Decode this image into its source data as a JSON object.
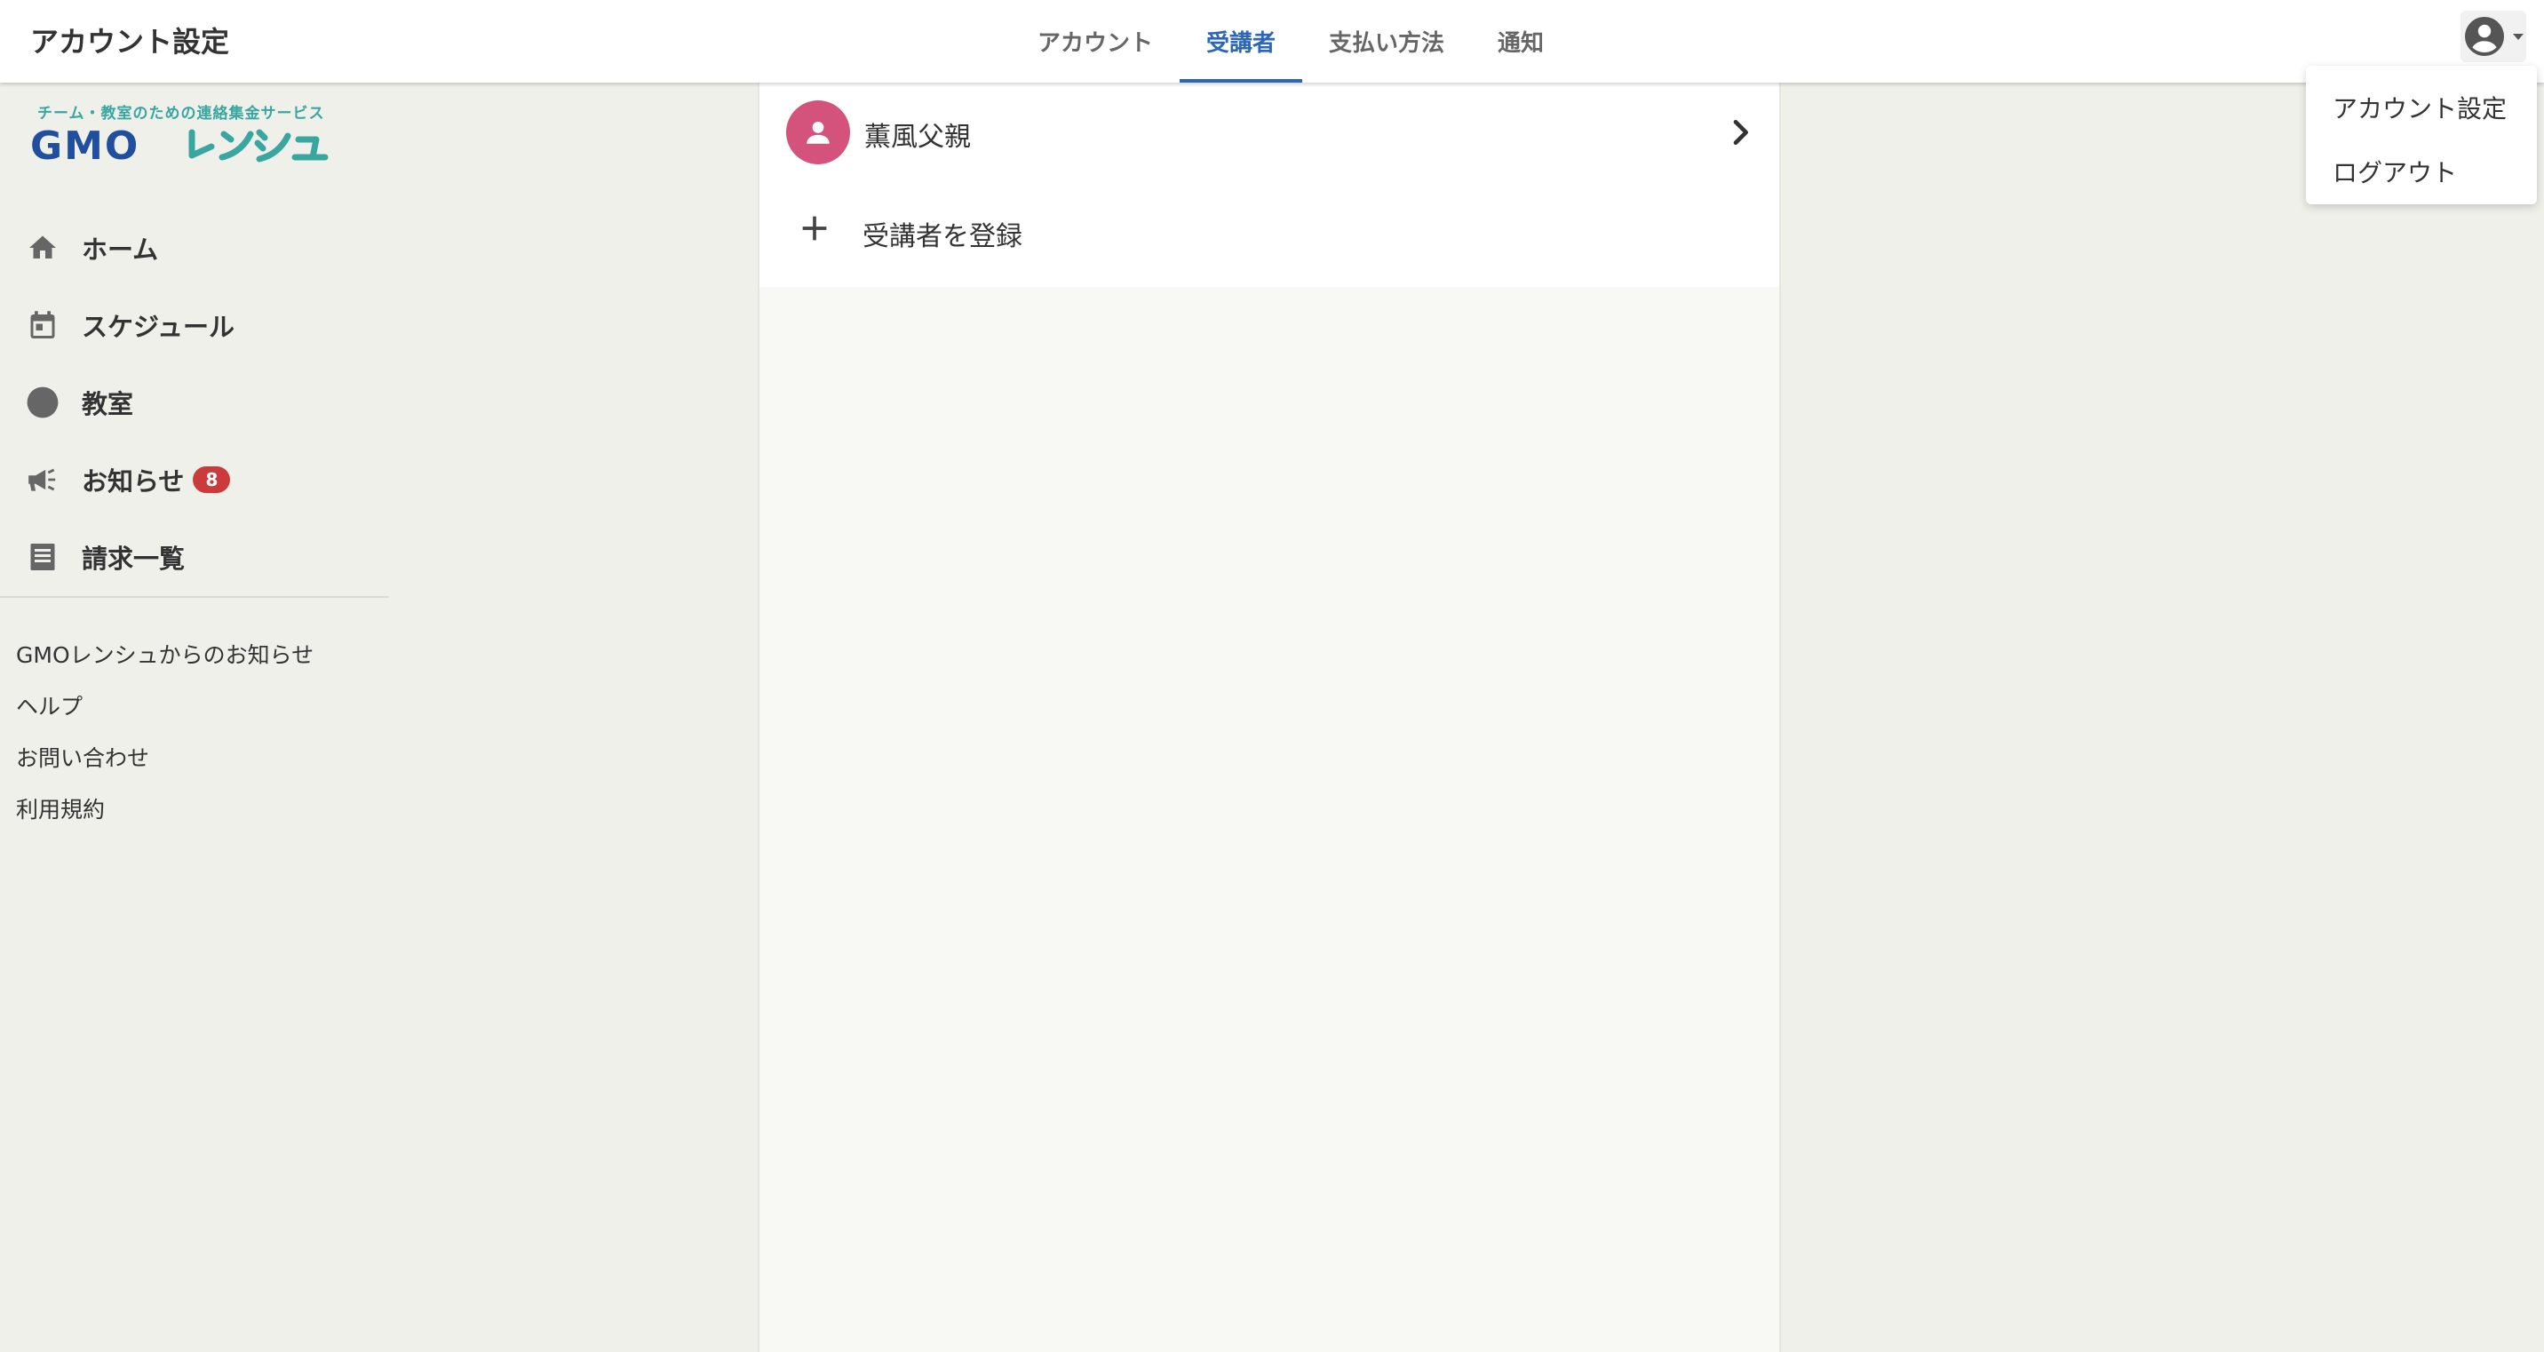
{
  "header": {
    "title": "アカウント設定",
    "tabs": [
      {
        "label": "アカウント"
      },
      {
        "label": "受講者",
        "active": true
      },
      {
        "label": "支払い方法"
      },
      {
        "label": "通知"
      }
    ],
    "account_icon": "account-circle-icon"
  },
  "dropdown": {
    "items": [
      {
        "label": "アカウント設定"
      },
      {
        "label": "ログアウト"
      }
    ]
  },
  "sidebar": {
    "logo": {
      "tagline": "チーム・教室のための連絡集金サービス",
      "brand": "GMOレンシュ"
    },
    "nav": [
      {
        "label": "ホーム",
        "icon": "home-icon"
      },
      {
        "label": "スケジュール",
        "icon": "calendar-icon"
      },
      {
        "label": "教室",
        "icon": "circle-icon"
      },
      {
        "label": "お知らせ",
        "icon": "megaphone-icon",
        "badge": "8"
      },
      {
        "label": "請求一覧",
        "icon": "receipt-icon"
      }
    ],
    "links": [
      {
        "label": "GMOレンシュからのお知らせ"
      },
      {
        "label": "ヘルプ"
      },
      {
        "label": "お問い合わせ"
      },
      {
        "label": "利用規約"
      }
    ]
  },
  "main": {
    "students": [
      {
        "name": "薫風父親",
        "avatar_icon": "person-icon"
      }
    ],
    "add_label": "受講者を登録"
  },
  "colors": {
    "accent": "#2b67b6",
    "avatar": "#d4537c",
    "badge": "#cc3b3b",
    "logo_teal": "#3aa6a0",
    "logo_blue": "#1f4f9e"
  }
}
